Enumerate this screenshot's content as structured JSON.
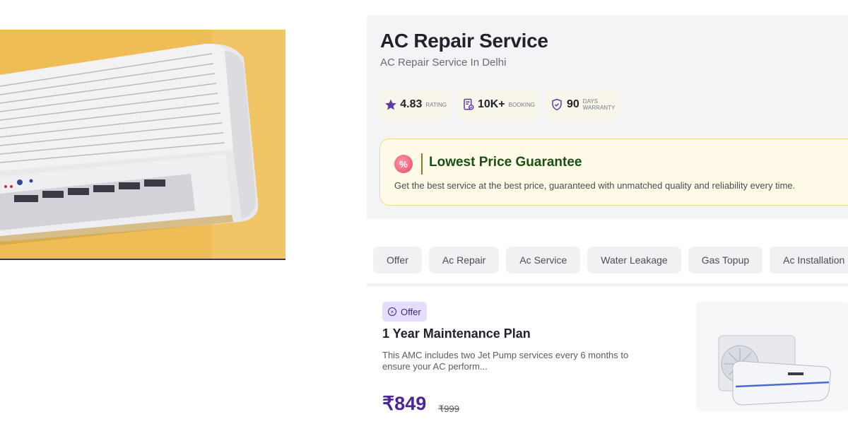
{
  "service": {
    "title": "AC Repair Service",
    "subtitle": "AC Repair Service In Delhi"
  },
  "stats": [
    {
      "icon": "star-icon",
      "value": "4.83",
      "caption": "RATING"
    },
    {
      "icon": "booking-receipt-icon",
      "value": "10K+",
      "caption": "BOOKING"
    },
    {
      "icon": "shield-check-icon",
      "value": "90",
      "caption_line1": "DAYS",
      "caption_line2": "WARRANTY"
    }
  ],
  "guarantee": {
    "badge": "%",
    "title": "Lowest Price Guarantee",
    "text": "Get the best service at the best price, guaranteed with unmatched quality and reliability every time."
  },
  "tabs": [
    "Offer",
    "Ac Repair",
    "Ac Service",
    "Water Leakage",
    "Gas Topup",
    "Ac Installation"
  ],
  "offer_card": {
    "badge": "Offer",
    "title": "1 Year Maintenance Plan",
    "description": "This AMC includes two Jet Pump services every 6 months to ensure your AC perform...",
    "price": "₹849",
    "old_price": "₹999"
  },
  "colors": {
    "accent": "#4b2796",
    "guarantee_title": "#1a4e17",
    "guarantee_bg": "#fffbe7",
    "panel_bg": "#f4f4f6"
  }
}
